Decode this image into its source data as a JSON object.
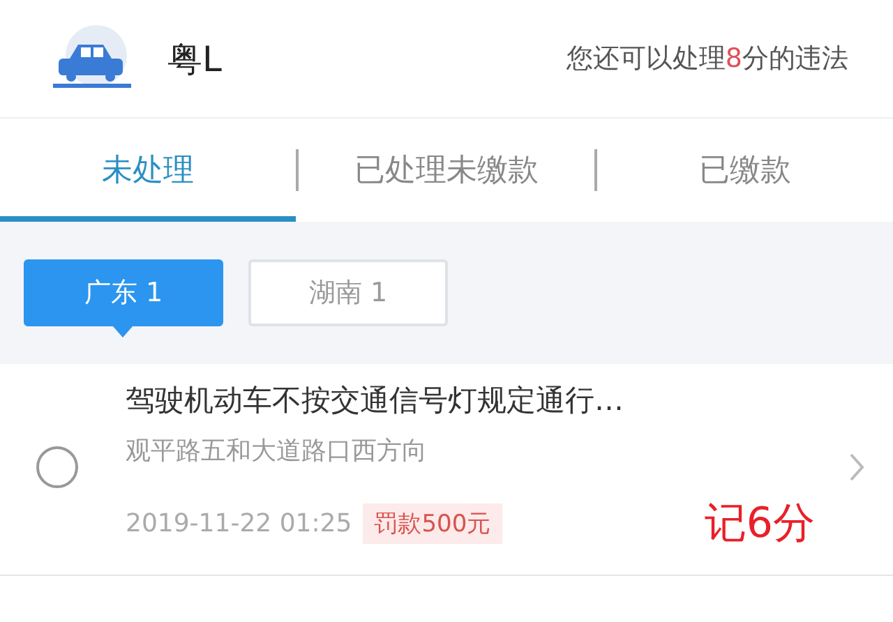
{
  "header": {
    "plate": "粤L",
    "notice_prefix": "您还可以处理",
    "notice_points": "8",
    "notice_suffix": "分的违法"
  },
  "tabs": [
    {
      "label": "未处理",
      "selected": true
    },
    {
      "label": "已处理未缴款",
      "selected": false
    },
    {
      "label": "已缴款",
      "selected": false
    }
  ],
  "provinces": [
    {
      "label": "广东 1",
      "selected": true
    },
    {
      "label": "湖南 1",
      "selected": false
    }
  ],
  "violations": [
    {
      "title": "驾驶机动车不按交通信号灯规定通行…",
      "location": "观平路五和大道路口西方向",
      "time": "2019-11-22 01:25",
      "fine": "罚款500元",
      "checked": false,
      "points_note": "记6分"
    }
  ]
}
